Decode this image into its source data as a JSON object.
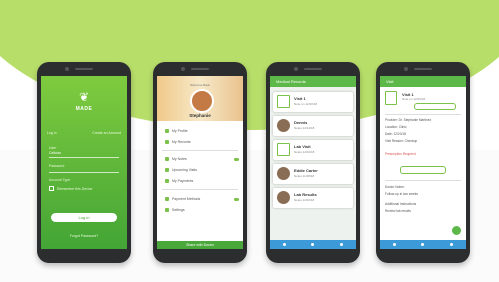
{
  "phones": {
    "login": {
      "app_name": "MADE",
      "tab_a": "Log In",
      "tab_b": "Create an Account",
      "field1_label": "User",
      "field1_value": "Cellular",
      "field2_label": "Password",
      "field3_label": "Account Type",
      "checkbox_label": "Remember this Device",
      "button_label": "Log in",
      "footer": "Forgot Password?"
    },
    "profile": {
      "subtitle": "Welcome Back",
      "name": "Stephanie",
      "items": [
        "My Profile",
        "My Records",
        "My Notes",
        "Upcoming Visits",
        "My Payments",
        "Payment Methods",
        "Settings"
      ],
      "bottom_label": "Share with Doctor"
    },
    "list": {
      "title": "Medical Records",
      "cards": [
        {
          "title": "Visit 1",
          "sub": "Note on 12/20/18"
        },
        {
          "title": "Dennis",
          "sub": "Notes 12/14/18"
        },
        {
          "title": "Lab Visit",
          "sub": "Notes 12/10/18"
        },
        {
          "title": "Eddie Carter",
          "sub": "Notes 11/28/18"
        },
        {
          "title": "Lab Results",
          "sub": "Notes 11/02/18"
        }
      ]
    },
    "detail": {
      "title": "Visit",
      "heading": "Visit 1",
      "sub": "Note on 12/20/18",
      "lines": [
        "Provider: Dr. Stephanie Martinez",
        "Location: Clinic",
        "Date: 12/20/18",
        "Visit Reason: Checkup",
        "Doctor Notes:",
        "Follow-up in two weeks",
        "Additional Instructions",
        "Review lab results"
      ],
      "alert": "Prescription Required"
    }
  }
}
